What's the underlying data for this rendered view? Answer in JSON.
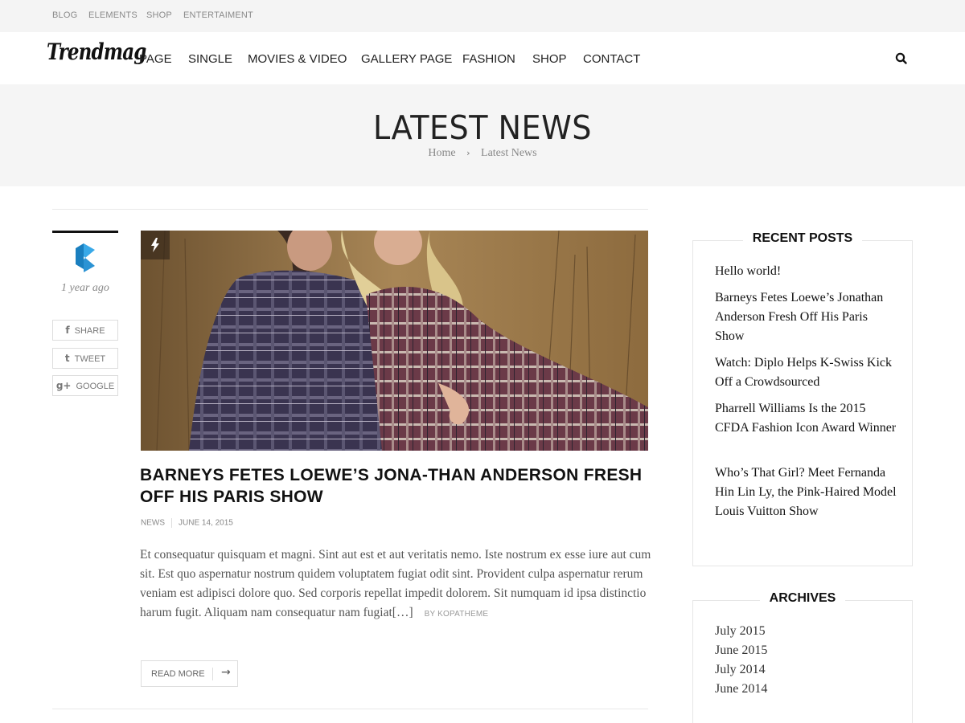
{
  "topbar": {
    "links": [
      "BLOG",
      "ELEMENTS",
      "SHOP",
      "ENTERTAIMENT"
    ]
  },
  "header": {
    "logo_text": "Trendmag",
    "nav": [
      "PAGE",
      "SINGLE",
      "MOVIES & VIDEO",
      "GALLERY PAGE",
      "FASHION",
      "SHOP",
      "CONTACT"
    ],
    "search_icon": "search-icon"
  },
  "page_header": {
    "title": "LATEST NEWS",
    "breadcrumb": [
      "Home",
      "Latest News"
    ]
  },
  "post": {
    "time_ago": "1 year ago",
    "share_buttons": [
      {
        "icon": "facebook-icon",
        "glyph": "f",
        "label": "SHARE"
      },
      {
        "icon": "twitter-icon",
        "glyph": "t",
        "label": "TWEET"
      },
      {
        "icon": "google-plus-icon",
        "glyph": "g+",
        "label": "GOOGLE"
      }
    ],
    "format_icon": "lightning-icon",
    "title": "BARNEYS FETES LOEWE’S JONA-THAN ANDERSON FRESH OFF HIS PARIS SHOW",
    "category": "NEWS",
    "date": "JUNE 14, 2015",
    "excerpt": "Et consequatur quisquam et magni. Sint aut est et aut veritatis nemo. Iste nostrum ex esse iure aut cum sit. Est quo aspernatur nostrum quidem voluptatem fugiat odit sint. Provident culpa aspernatur rerum veniam est adipisci dolore quo. Sed corporis repellat impedit dolorem. Sit numquam id ipsa distinctio harum fugit. Aliquam nam consequatur nam fugiat[…]",
    "author": "BY KOPATHEME",
    "read_more": "READ MORE"
  },
  "sidebar": {
    "recent_posts": {
      "title": "RECENT POSTS",
      "items": [
        "Hello world!",
        "Barneys Fetes Loewe’s Jonathan Anderson Fresh Off His Paris Show",
        "Watch: Diplo Helps K-Swiss Kick Off a Crowdsourced",
        "Pharrell Williams Is the 2015 CFDA Fashion Icon Award Winner",
        "Who’s That Girl? Meet Fernanda Hin Lin Ly, the Pink-Haired Model Louis Vuitton Show"
      ]
    },
    "archives": {
      "title": "ARCHIVES",
      "items": [
        "July 2015",
        "June 2015",
        "July 2014",
        "June 2014"
      ]
    }
  }
}
